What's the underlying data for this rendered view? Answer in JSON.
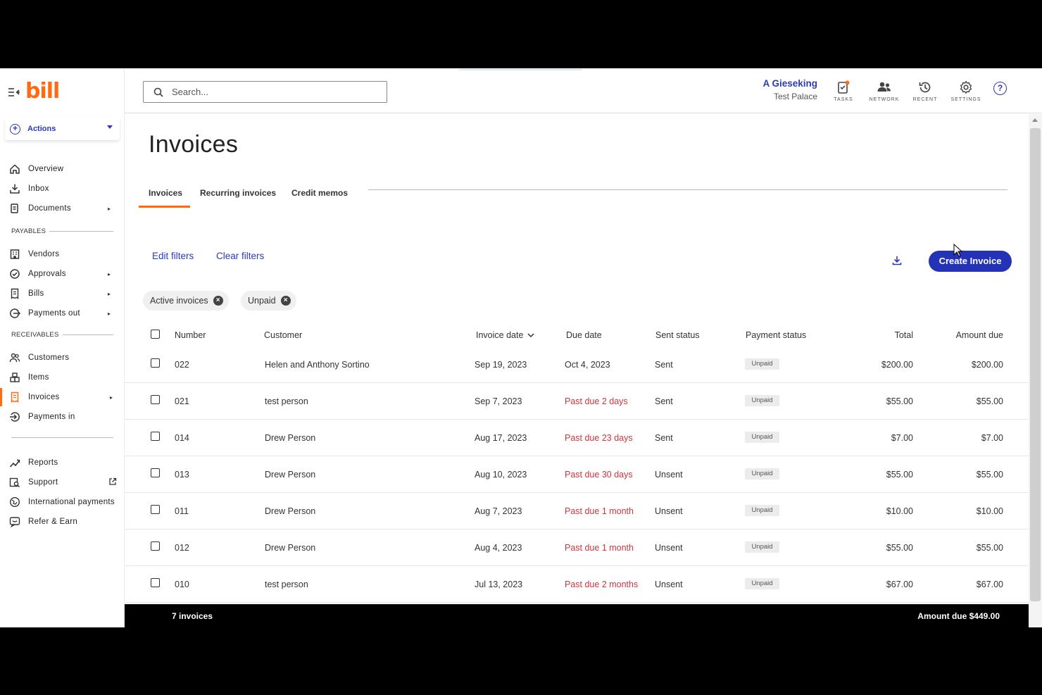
{
  "app": {
    "logo": "bill"
  },
  "sidebar": {
    "actions_label": "Actions",
    "top_items": [
      {
        "label": "Overview",
        "icon": "home-icon"
      },
      {
        "label": "Inbox",
        "icon": "inbox-download-icon"
      },
      {
        "label": "Documents",
        "icon": "documents-icon"
      }
    ],
    "payables_label": "PAYABLES",
    "payables": [
      {
        "label": "Vendors",
        "icon": "vendors-icon"
      },
      {
        "label": "Approvals",
        "icon": "approvals-check-icon"
      },
      {
        "label": "Bills",
        "icon": "bills-icon"
      },
      {
        "label": "Payments out",
        "icon": "payments-out-icon"
      }
    ],
    "receivables_label": "RECEIVABLES",
    "receivables": [
      {
        "label": "Customers",
        "icon": "customers-icon"
      },
      {
        "label": "Items",
        "icon": "items-icon"
      },
      {
        "label": "Invoices",
        "icon": "invoices-icon"
      },
      {
        "label": "Payments in",
        "icon": "payments-in-icon"
      }
    ],
    "bottom": [
      {
        "label": "Reports",
        "icon": "reports-chart-icon"
      },
      {
        "label": "Support",
        "icon": "support-book-icon"
      },
      {
        "label": "International payments",
        "icon": "globe-payment-icon"
      },
      {
        "label": "Refer & Earn",
        "icon": "refer-chat-icon"
      }
    ]
  },
  "topbar": {
    "search_placeholder": "Search...",
    "user_name": "A Gieseking",
    "user_org": "Test Palace",
    "icons": [
      {
        "label": "TASKS",
        "icon": "tasks-clipboard-icon"
      },
      {
        "label": "NETWORK",
        "icon": "network-people-icon"
      },
      {
        "label": "RECENT",
        "icon": "recent-history-icon"
      },
      {
        "label": "SETTINGS",
        "icon": "settings-gear-icon"
      }
    ],
    "help": "?"
  },
  "page": {
    "title": "Invoices",
    "tabs": [
      "Invoices",
      "Recurring invoices",
      "Credit memos"
    ],
    "edit_filters": "Edit filters",
    "clear_filters": "Clear filters",
    "create_invoice": "Create Invoice",
    "chips": [
      "Active invoices",
      "Unpaid"
    ]
  },
  "table": {
    "headers": {
      "number": "Number",
      "customer": "Customer",
      "invoice_date": "Invoice date",
      "due_date": "Due date",
      "sent_status": "Sent status",
      "payment_status": "Payment status",
      "total": "Total",
      "amount_due": "Amount due"
    },
    "rows": [
      {
        "number": "022",
        "customer": "Helen and Anthony Sortino",
        "invoice_date": "Sep 19, 2023",
        "due_date": "Oct 4, 2023",
        "overdue": false,
        "sent_status": "Sent",
        "payment_status": "Unpaid",
        "total": "$200.00",
        "amount_due": "$200.00"
      },
      {
        "number": "021",
        "customer": "test person",
        "invoice_date": "Sep 7, 2023",
        "due_date": "Past due 2 days",
        "overdue": true,
        "sent_status": "Sent",
        "payment_status": "Unpaid",
        "total": "$55.00",
        "amount_due": "$55.00"
      },
      {
        "number": "014",
        "customer": "Drew Person",
        "invoice_date": "Aug 17, 2023",
        "due_date": "Past due 23 days",
        "overdue": true,
        "sent_status": "Sent",
        "payment_status": "Unpaid",
        "total": "$7.00",
        "amount_due": "$7.00"
      },
      {
        "number": "013",
        "customer": "Drew Person",
        "invoice_date": "Aug 10, 2023",
        "due_date": "Past due 30 days",
        "overdue": true,
        "sent_status": "Unsent",
        "payment_status": "Unpaid",
        "total": "$55.00",
        "amount_due": "$55.00"
      },
      {
        "number": "011",
        "customer": "Drew Person",
        "invoice_date": "Aug 7, 2023",
        "due_date": "Past due 1 month",
        "overdue": true,
        "sent_status": "Unsent",
        "payment_status": "Unpaid",
        "total": "$10.00",
        "amount_due": "$10.00"
      },
      {
        "number": "012",
        "customer": "Drew Person",
        "invoice_date": "Aug 4, 2023",
        "due_date": "Past due 1 month",
        "overdue": true,
        "sent_status": "Unsent",
        "payment_status": "Unpaid",
        "total": "$55.00",
        "amount_due": "$55.00"
      },
      {
        "number": "010",
        "customer": "test person",
        "invoice_date": "Jul 13, 2023",
        "due_date": "Past due 2 months",
        "overdue": true,
        "sent_status": "Unsent",
        "payment_status": "Unpaid",
        "total": "$67.00",
        "amount_due": "$67.00"
      }
    ]
  },
  "footer": {
    "count": "7 invoices",
    "amount_due": "Amount due $449.00"
  },
  "colors": {
    "brand": "#ff6a13",
    "accent": "#2b3ab8",
    "overdue": "#d0343e"
  }
}
